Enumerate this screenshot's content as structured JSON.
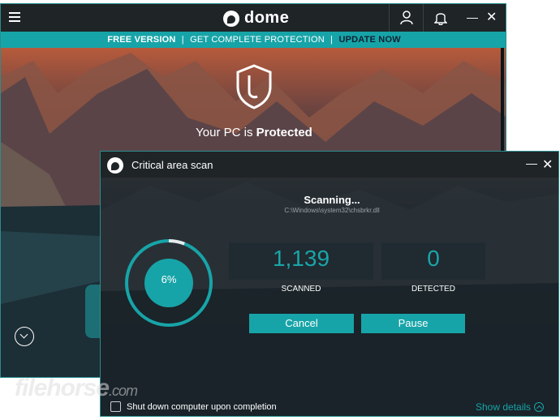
{
  "main_window": {
    "brand": "dome",
    "promo": {
      "free_version": "FREE VERSION",
      "separator": "|",
      "get_protection": "GET COMPLETE PROTECTION",
      "update_now": "UPDATE NOW"
    },
    "status_prefix": "Your PC is",
    "status_word": "Protected"
  },
  "scan_dialog": {
    "title": "Critical area scan",
    "scanning_label": "Scanning...",
    "current_file": "C:\\Windows\\system32\\chsbrkr.dll",
    "progress_percent": 6,
    "progress_text": "6%",
    "scanned_value": "1,139",
    "scanned_label": "SCANNED",
    "detected_value": "0",
    "detected_label": "DETECTED",
    "cancel_label": "Cancel",
    "pause_label": "Pause",
    "shutdown_label": "Shut down computer upon completion",
    "show_details_label": "Show details"
  },
  "watermark": {
    "main": "filehorse",
    "suffix": ".com"
  },
  "colors": {
    "accent": "#17a4a8",
    "titlebar": "#1f2427"
  },
  "icons": [
    "hamburger-icon",
    "user-icon",
    "bell-icon",
    "minimize-icon",
    "close-icon",
    "shield-icon",
    "chevron-down-icon",
    "chevron-up-icon",
    "panda-logo-icon"
  ]
}
